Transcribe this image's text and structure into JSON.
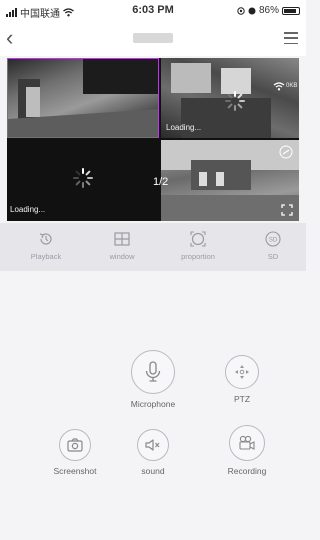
{
  "status_bar": {
    "carrier": "中国联通",
    "time": "6:03 PM",
    "battery": "86%"
  },
  "video": {
    "loading_label": "Loading...",
    "page_indicator": "1/2",
    "stream_badge": "0KB"
  },
  "toolbar": {
    "items": [
      {
        "label": "Playback",
        "icon": "playback-icon"
      },
      {
        "label": "window",
        "icon": "window-grid-icon"
      },
      {
        "label": "proportion",
        "icon": "proportion-icon"
      },
      {
        "label": "SD",
        "icon": "sd-quality-icon"
      }
    ]
  },
  "controls": {
    "microphone": "Microphone",
    "ptz": "PTZ",
    "screenshot": "Screenshot",
    "sound": "sound",
    "recording": "Recording"
  }
}
